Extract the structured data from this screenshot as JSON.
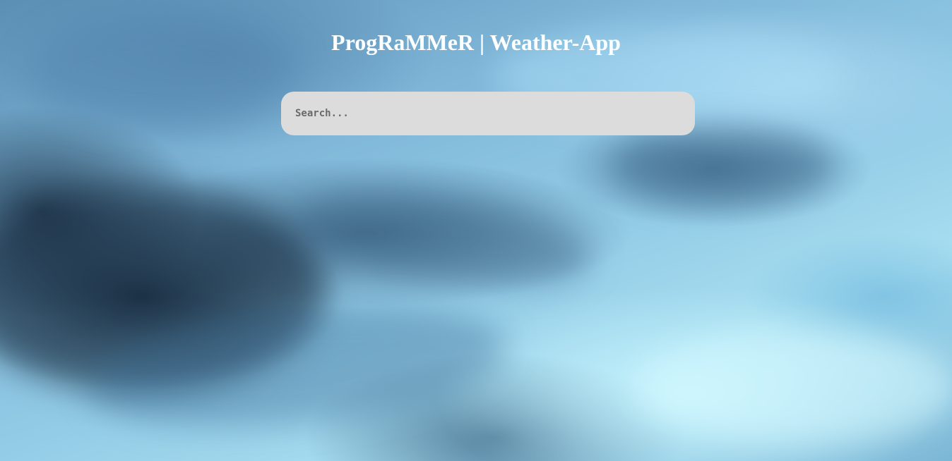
{
  "header": {
    "title": "ProgRaMMeR | Weather-App"
  },
  "search": {
    "placeholder": "Search...",
    "value": ""
  },
  "background": {
    "description_colors": {
      "sky_light": "#a8def0",
      "sky_mid": "#7fb6d8",
      "cloud_dark": "#1e3550"
    }
  },
  "colors": {
    "title_text": "#ffffff",
    "search_background": "#dcdcdc",
    "search_placeholder": "#6a6a6a"
  }
}
